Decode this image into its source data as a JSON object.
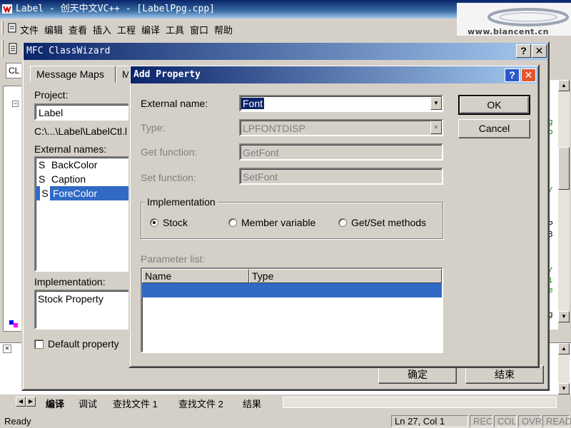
{
  "ide": {
    "title": "Label - 创天中文VC++ - [LabelPpg.cpp]",
    "watermark": "www.biancent.cn",
    "menu": [
      "文件",
      "编辑",
      "查看",
      "插入",
      "工程",
      "编译",
      "工具",
      "窗口",
      "帮助"
    ],
    "left_tab": "CL",
    "code_chars": [
      "g",
      "o",
      "/",
      "P",
      "3",
      "/",
      "i",
      "e",
      "g"
    ],
    "output_tabs": [
      "编译",
      "调试",
      "查找文件 1",
      "查找文件 2",
      "结果"
    ],
    "status": {
      "ready": "Ready",
      "position": "Ln 27, Col 1",
      "rec": "REC",
      "col": "COL",
      "ovr": "OVR",
      "read": "READ"
    }
  },
  "classwizard": {
    "title": "MFC ClassWizard",
    "tabs": [
      "Message Maps",
      "M"
    ],
    "project_label": "Project:",
    "project_value": "Label",
    "path": "C:\\...\\Label\\LabelCtl.l",
    "external_names_label": "External names:",
    "external_names": [
      {
        "prefix": "S",
        "name": "BackColor"
      },
      {
        "prefix": "S",
        "name": "Caption"
      },
      {
        "prefix": "S",
        "name": "ForeColor"
      }
    ],
    "selected_index": 2,
    "implementation_label": "Implementation:",
    "implementation_value": "Stock Property",
    "default_property_label": "Default property",
    "ok_label": "确定",
    "cancel_label": "结束"
  },
  "add_property": {
    "title": "Add Property",
    "external_name_label": "External name:",
    "external_name_value": "Font",
    "type_label": "Type:",
    "type_value": "LPFONTDISP",
    "get_function_label": "Get function:",
    "get_function_value": "GetFont",
    "set_function_label": "Set function:",
    "set_function_value": "SetFont",
    "implementation_group": "Implementation",
    "options": [
      {
        "label": "Stock",
        "selected": true
      },
      {
        "label": "Member variable",
        "selected": false
      },
      {
        "label": "Get/Set methods",
        "selected": false
      }
    ],
    "parameter_list_label": "Parameter list:",
    "columns": [
      "Name",
      "Type"
    ],
    "ok_label": "OK",
    "cancel_label": "Cancel"
  },
  "colors": {
    "title_active": "#0a246a",
    "selection": "#0a246a",
    "dialog_face": "#d4d0c8",
    "param_selection": "#316ac5"
  }
}
